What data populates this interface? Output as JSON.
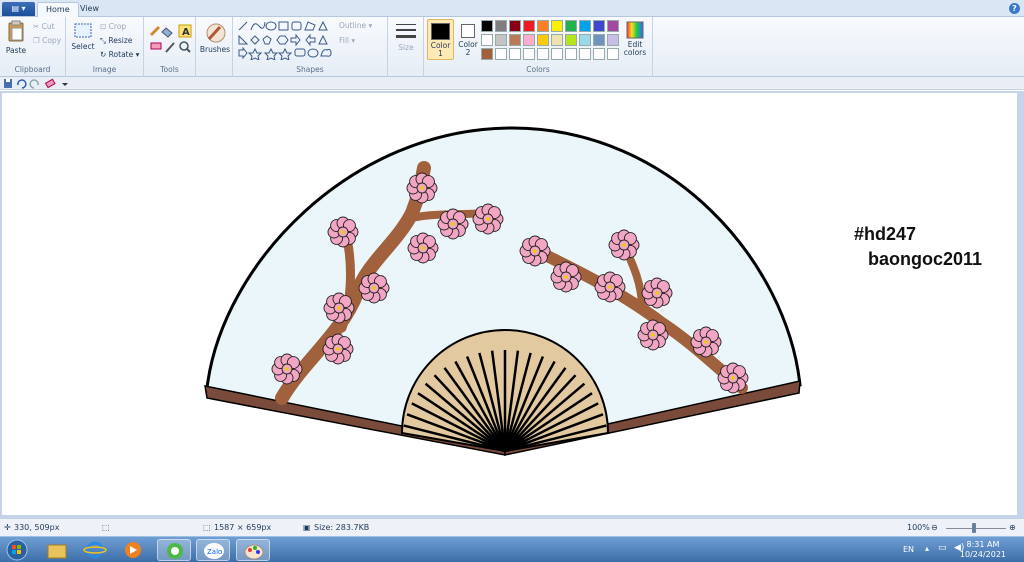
{
  "tabs": {
    "file_label": "▤ ▾",
    "home": "Home",
    "view": "View",
    "help": "?"
  },
  "ribbon": {
    "clipboard": {
      "paste": "Paste",
      "cut": "Cut",
      "copy": "Copy",
      "label": "Clipboard"
    },
    "image": {
      "select": "Select",
      "crop": "Crop",
      "resize": "Resize",
      "rotate": "Rotate ▾",
      "label": "Image"
    },
    "tools": {
      "label": "Tools"
    },
    "brushes": {
      "label": "Brushes"
    },
    "shapes": {
      "outline": "Outline ▾",
      "fill": "Fill ▾",
      "label": "Shapes"
    },
    "size": {
      "label": "Size"
    },
    "colors": {
      "color1_label": "Color\n1",
      "color2_label": "Color\n2",
      "edit_label": "Edit\ncolors",
      "label": "Colors",
      "color1": "#000000",
      "color2": "#ffffff",
      "palette_row1": [
        "#000000",
        "#7f7f7f",
        "#880015",
        "#ed1c24",
        "#ff7f27",
        "#fff200",
        "#22b14c",
        "#00a2e8",
        "#3f48cc",
        "#a349a4"
      ],
      "palette_row2": [
        "#ffffff",
        "#c3c3c3",
        "#b97a57",
        "#ffaec9",
        "#ffc90e",
        "#efe4b0",
        "#b5e61d",
        "#99d9ea",
        "#7092be",
        "#c8bfe7"
      ],
      "palette_row3": [
        "#a0613c",
        "#ffffff",
        "#ffffff",
        "#ffffff",
        "#ffffff",
        "#ffffff",
        "#ffffff",
        "#ffffff",
        "#ffffff",
        "#ffffff"
      ]
    }
  },
  "canvas": {
    "text_line1": "#hd247",
    "text_line2": "baongoc2011"
  },
  "status": {
    "cursor_pos": "330, 509px",
    "image_size": "1587 × 659px",
    "file_size": "Size: 283.7KB",
    "zoom": "100%"
  },
  "taskbar": {
    "lang": "EN",
    "time": "8:31 AM",
    "date": "10/24/2021",
    "apps": [
      "start-orb",
      "file-explorer",
      "internet-explorer",
      "media-player",
      "coccoc",
      "zalo",
      "paint"
    ]
  }
}
